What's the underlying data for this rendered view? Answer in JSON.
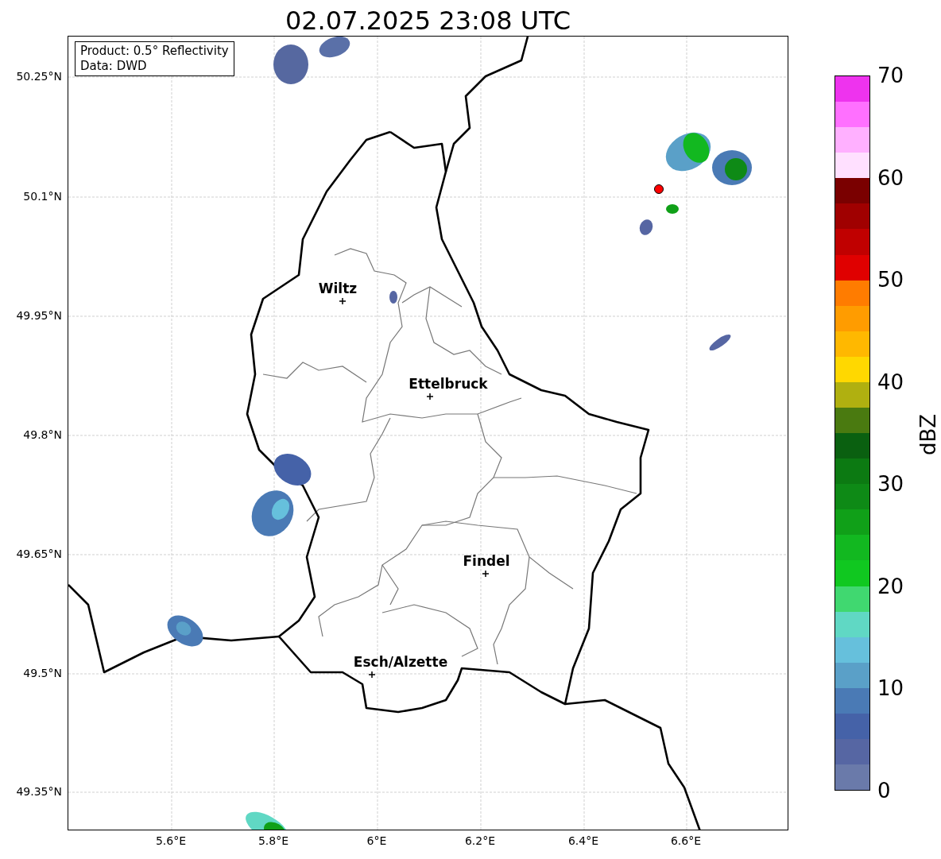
{
  "title": "02.07.2025 23:08 UTC",
  "info_box": [
    "Product: 0.5° Reflectivity",
    "Data: DWD"
  ],
  "lat_labels": [
    "50.25°N",
    "50.1°N",
    "49.95°N",
    "49.8°N",
    "49.65°N",
    "49.5°N",
    "49.35°N"
  ],
  "lon_labels": [
    "5.6°E",
    "5.8°E",
    "6°E",
    "6.2°E",
    "6.4°E",
    "6.6°E"
  ],
  "cities": [
    {
      "name": "Wiltz"
    },
    {
      "name": "Ettelbruck"
    },
    {
      "name": "Findel"
    },
    {
      "name": "Esch/Alzette"
    }
  ],
  "colorbar": {
    "label": "dBZ",
    "ticks": [
      "70",
      "60",
      "50",
      "40",
      "30",
      "20",
      "10",
      "0"
    ],
    "bands": [
      {
        "color": "#ee33ee"
      },
      {
        "color": "#ff70ff"
      },
      {
        "color": "#ffb0ff"
      },
      {
        "color": "#ffe0ff"
      },
      {
        "color": "#7a0000"
      },
      {
        "color": "#a00000"
      },
      {
        "color": "#c00000"
      },
      {
        "color": "#e00000"
      },
      {
        "color": "#ff7c00"
      },
      {
        "color": "#ff9c00"
      },
      {
        "color": "#ffb800"
      },
      {
        "color": "#ffd800"
      },
      {
        "color": "#b0b010"
      },
      {
        "color": "#4a7a10"
      },
      {
        "color": "#0a6010"
      },
      {
        "color": "#0c7a12"
      },
      {
        "color": "#0e8a16"
      },
      {
        "color": "#10a018"
      },
      {
        "color": "#12b820"
      },
      {
        "color": "#10c820"
      },
      {
        "color": "#40d870"
      },
      {
        "color": "#60d8c4"
      },
      {
        "color": "#66c0dc"
      },
      {
        "color": "#5aa0c8"
      },
      {
        "color": "#4a7ab5"
      },
      {
        "color": "#4562a8"
      },
      {
        "color": "#5666a3"
      },
      {
        "color": "#6a7aaa"
      }
    ]
  }
}
